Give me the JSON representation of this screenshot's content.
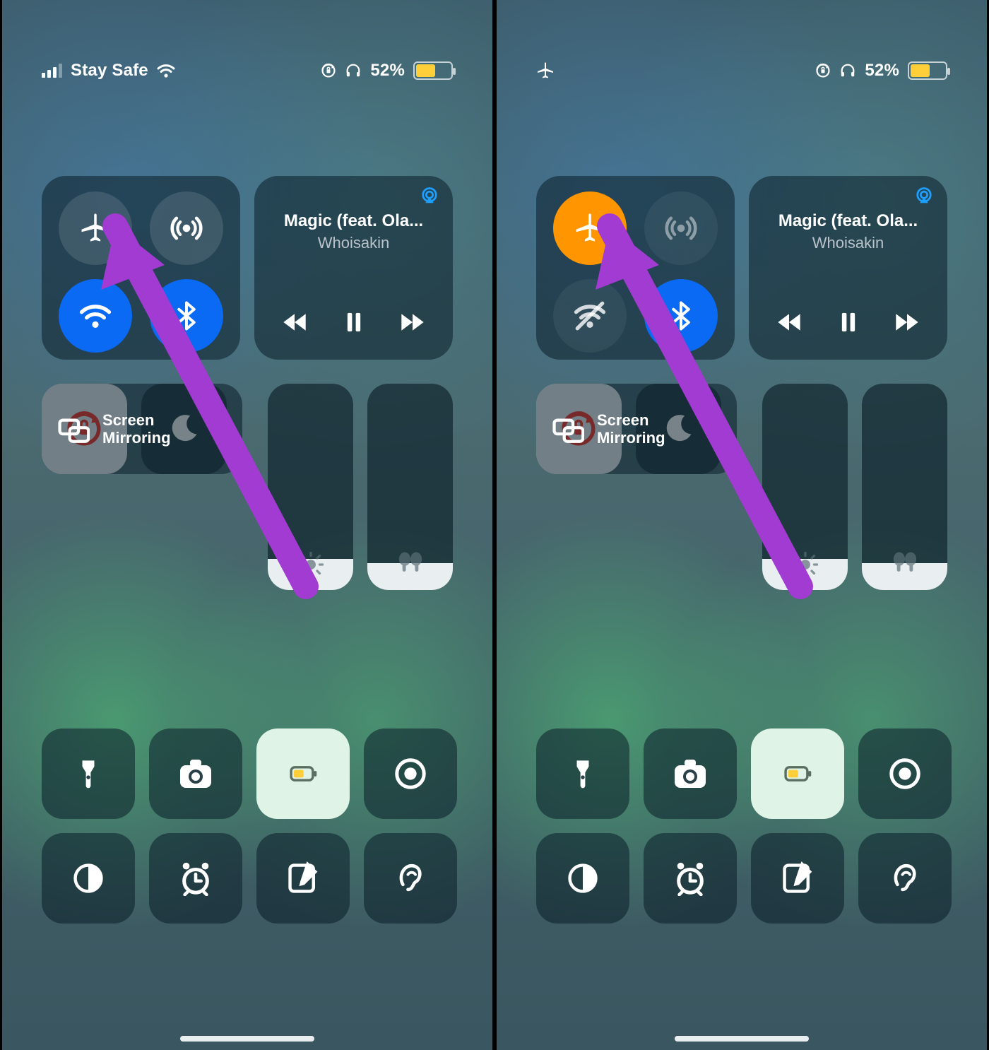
{
  "screens": [
    {
      "status": {
        "carrier": "Stay Safe",
        "cell_signal": 3,
        "show_cell": true,
        "wifi": true,
        "airplane_in_status": false,
        "battery_pct": "52%",
        "battery_level": 0.52,
        "orientation_locked": true,
        "headphones": true
      },
      "connectivity": {
        "airplane_on": false,
        "cellular_on": true,
        "wifi_on": true,
        "bluetooth_on": true,
        "wifi_slashed": false
      },
      "media": {
        "title": "Magic (feat. Ola...",
        "artist": "Whoisakin",
        "is_playing": true
      },
      "orientation_lock_on": true,
      "dnd_on": false,
      "mirroring_label_line1": "Screen",
      "mirroring_label_line2": "Mirroring",
      "brightness": 0.15,
      "volume": 0.13,
      "low_power_mode": true,
      "arrow_color": "#a23bd1"
    },
    {
      "status": {
        "carrier": "",
        "cell_signal": 0,
        "show_cell": false,
        "wifi": false,
        "airplane_in_status": true,
        "battery_pct": "52%",
        "battery_level": 0.52,
        "orientation_locked": true,
        "headphones": true
      },
      "connectivity": {
        "airplane_on": true,
        "cellular_on": false,
        "wifi_on": false,
        "bluetooth_on": true,
        "wifi_slashed": true
      },
      "media": {
        "title": "Magic (feat. Ola...",
        "artist": "Whoisakin",
        "is_playing": true
      },
      "orientation_lock_on": true,
      "dnd_on": false,
      "mirroring_label_line1": "Screen",
      "mirroring_label_line2": "Mirroring",
      "brightness": 0.15,
      "volume": 0.13,
      "low_power_mode": true,
      "arrow_color": "#a23bd1"
    }
  ],
  "icons": {
    "airplane": "airplane-icon",
    "cell": "cellular-icon",
    "wifi": "wifi-icon",
    "bt": "bluetooth-icon",
    "lock": "orientation-lock-icon",
    "moon": "dnd-icon",
    "mirror": "screen-mirroring-icon",
    "sun": "brightness-icon",
    "earbuds": "earbuds-volume-icon",
    "torch": "flashlight-icon",
    "camera": "camera-icon",
    "battery": "low-power-icon",
    "record": "screen-record-icon",
    "contrast": "dark-mode-icon",
    "alarm": "alarm-icon",
    "note": "quick-note-icon",
    "ear": "hearing-icon",
    "airplay": "airplay-icon",
    "headphones": "headphones-icon"
  }
}
